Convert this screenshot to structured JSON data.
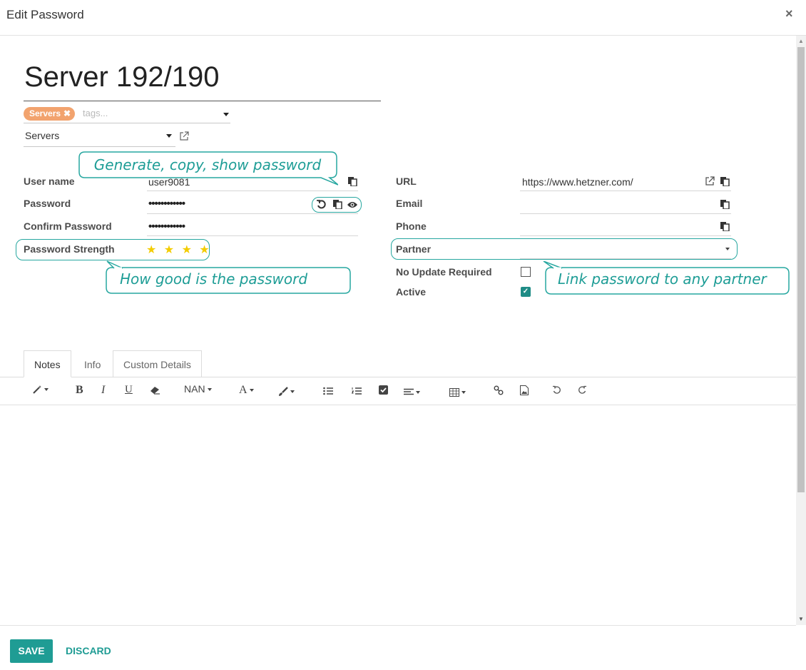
{
  "dialog": {
    "title": "Edit Password",
    "close_glyph": "×"
  },
  "record": {
    "name": "Server 192/190"
  },
  "tags": {
    "chip_label": "Servers",
    "chip_remove_glyph": "✖",
    "placeholder": "tags..."
  },
  "category": {
    "value": "Servers"
  },
  "fields": {
    "user_name": {
      "label": "User name",
      "value": "user9081"
    },
    "password": {
      "label": "Password",
      "value": "••••••••••••"
    },
    "confirm_password": {
      "label": "Confirm Password",
      "value": "••••••••••••"
    },
    "password_strength": {
      "label": "Password Strength",
      "stars": "★ ★ ★ ★",
      "level": 4
    },
    "url": {
      "label": "URL",
      "value": "https://www.hetzner.com/"
    },
    "email": {
      "label": "Email",
      "value": ""
    },
    "phone": {
      "label": "Phone",
      "value": ""
    },
    "partner": {
      "label": "Partner",
      "value": ""
    },
    "no_update_required": {
      "label": "No Update Required",
      "checked": false
    },
    "active": {
      "label": "Active",
      "checked": true
    }
  },
  "callouts": {
    "generate": "Generate, copy, show password",
    "strength": "How good is the password",
    "partner": "Link password to any partner"
  },
  "tabs": [
    {
      "label": "Notes",
      "active": true
    },
    {
      "label": "Info",
      "active": false
    },
    {
      "label": "Custom Details",
      "active": false
    }
  ],
  "toolbar": {
    "font_size": "NAN",
    "bold": "B",
    "italic": "I",
    "underline": "U",
    "font_color": "A"
  },
  "footer": {
    "save_label": "SAVE",
    "discard_label": "DISCARD"
  },
  "colors": {
    "accent": "#1f9c94",
    "tag": "#f2a36e",
    "star": "#f3cc00",
    "callout": "#27a7a0"
  },
  "icons": [
    "close-icon",
    "external-link-icon",
    "copy-icon",
    "refresh-icon",
    "eye-icon",
    "star-icon",
    "magic-wand-icon",
    "eraser-icon",
    "brush-icon",
    "list-ul-icon",
    "list-ol-icon",
    "checklist-icon",
    "align-icon",
    "table-icon",
    "link-icon",
    "image-icon",
    "undo-icon",
    "redo-icon"
  ]
}
